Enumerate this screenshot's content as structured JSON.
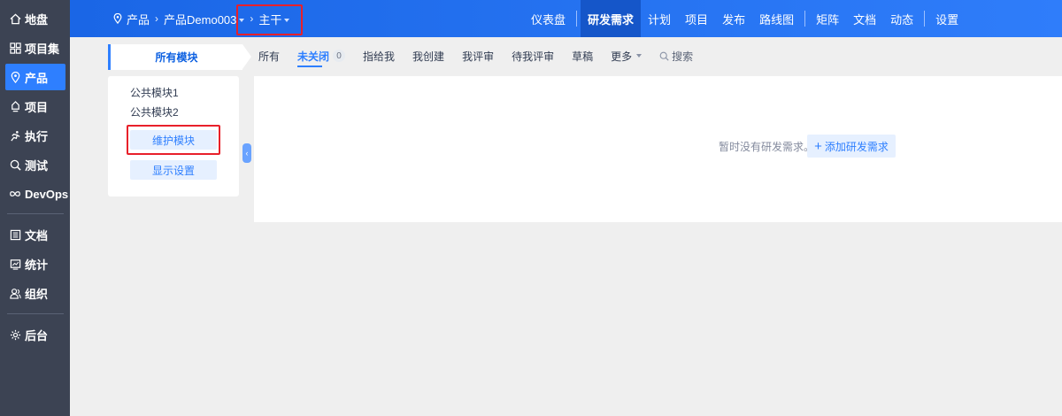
{
  "sidebar": {
    "items": [
      {
        "label": "地盘",
        "icon": "home-icon"
      },
      {
        "label": "项目集",
        "icon": "program-grid-icon"
      },
      {
        "label": "产品",
        "icon": "product-pin-icon",
        "active": true
      },
      {
        "label": "项目",
        "icon": "project-icon"
      },
      {
        "label": "执行",
        "icon": "execution-run-icon"
      },
      {
        "label": "测试",
        "icon": "test-search-icon"
      },
      {
        "label": "DevOps",
        "icon": "devops-infinity-icon"
      },
      {
        "label": "文档",
        "icon": "doc-icon"
      },
      {
        "label": "统计",
        "icon": "stats-icon"
      },
      {
        "label": "组织",
        "icon": "org-users-icon"
      },
      {
        "label": "后台",
        "icon": "admin-gear-icon"
      }
    ]
  },
  "breadcrumb": {
    "root": "产品",
    "product": "产品Demo003",
    "branch": "主干"
  },
  "topnav": {
    "items": [
      "仪表盘",
      "研发需求",
      "计划",
      "项目",
      "发布",
      "路线图",
      "矩阵",
      "文档",
      "动态",
      "设置"
    ],
    "active": "研发需求"
  },
  "modules": {
    "header": "所有模块",
    "items": [
      "公共模块1",
      "公共模块2"
    ],
    "maintain_button": "维护模块",
    "display_settings_button": "显示设置"
  },
  "filters": {
    "tabs": [
      "所有",
      "未关闭",
      "指给我",
      "我创建",
      "我评审",
      "待我评审",
      "草稿",
      "更多"
    ],
    "active": "未关闭",
    "unclosed_count": "0",
    "search_label": "搜索"
  },
  "main": {
    "empty_text": "暂时没有研发需求。",
    "add_button": "添加研发需求"
  },
  "colors": {
    "sidebar_bg": "#3c4353",
    "brand_blue": "#2e7fff",
    "highlight_red": "#e8202a"
  }
}
